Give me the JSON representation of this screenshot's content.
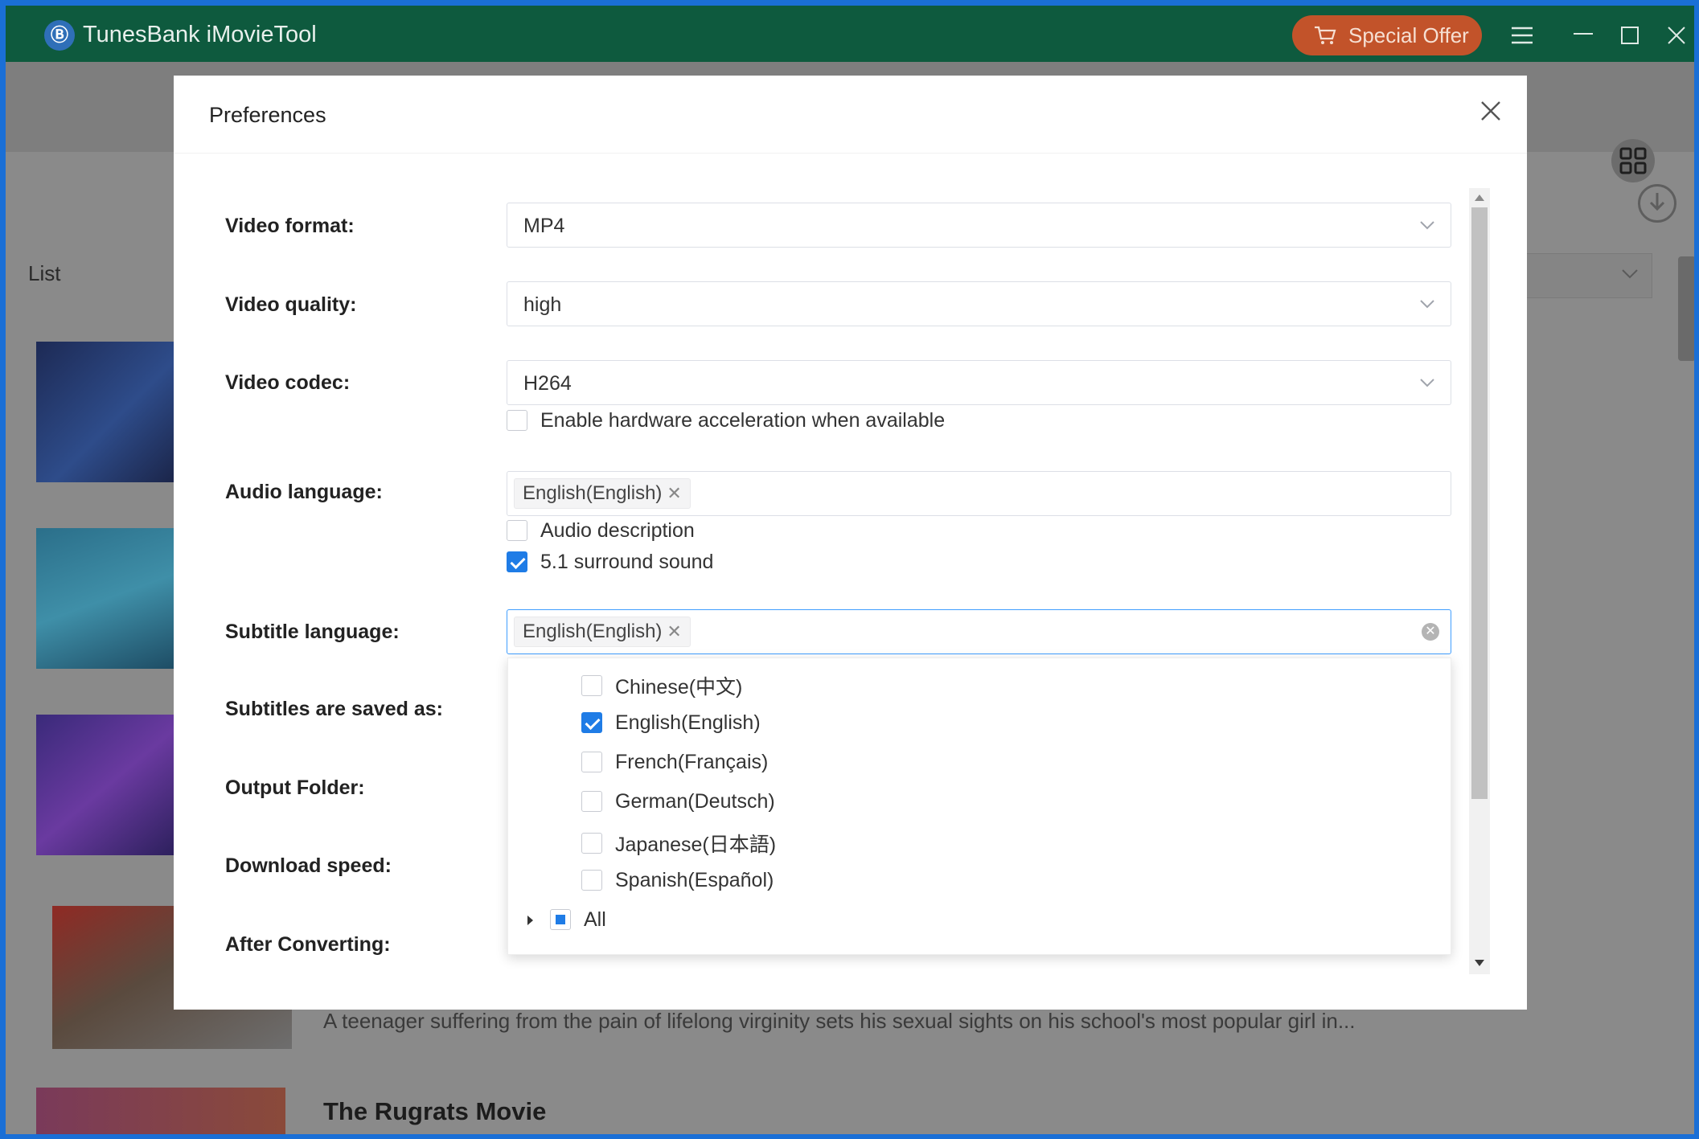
{
  "app": {
    "title": "TunesBank iMovieTool",
    "logo_glyph": "Ⓑ",
    "special_offer": "Special Offer"
  },
  "background": {
    "list_label": "List",
    "description_snippet": "A teenager suffering from the pain of lifelong virginity sets his sexual sights on his school's most popular girl in...",
    "next_title": "The Rugrats Movie"
  },
  "dialog": {
    "title": "Preferences",
    "close_glyph": "✕",
    "video_format": {
      "label": "Video format:",
      "value": "MP4"
    },
    "video_quality": {
      "label": "Video quality:",
      "value": "high"
    },
    "video_codec": {
      "label": "Video codec:",
      "value": "H264"
    },
    "hw_accel": {
      "label": "Enable hardware acceleration when available",
      "checked": false
    },
    "audio_language": {
      "label": "Audio language:",
      "tag": "English(English)"
    },
    "audio_description": {
      "label": "Audio description",
      "checked": false
    },
    "surround": {
      "label": "5.1 surround sound",
      "checked": true
    },
    "subtitle_language": {
      "label": "Subtitle language:",
      "tag": "English(English)"
    },
    "subtitles_saved_as": {
      "label": "Subtitles are saved as:"
    },
    "output_folder": {
      "label": "Output Folder:"
    },
    "download_speed": {
      "label": "Download speed:"
    },
    "after_converting": {
      "label": "After Converting:"
    },
    "subtitle_options": [
      {
        "label": "Chinese(中文)",
        "checked": false
      },
      {
        "label": "English(English)",
        "checked": true
      },
      {
        "label": "French(Français)",
        "checked": false
      },
      {
        "label": "German(Deutsch)",
        "checked": false
      },
      {
        "label": "Japanese(日本語)",
        "checked": false
      },
      {
        "label": "Spanish(Español)",
        "checked": false
      }
    ],
    "all_option": {
      "label": "All",
      "state": "partial"
    }
  },
  "colors": {
    "titlebar": "#0e5a3e",
    "accent": "#1f7ce6",
    "offer": "#c2532a"
  }
}
